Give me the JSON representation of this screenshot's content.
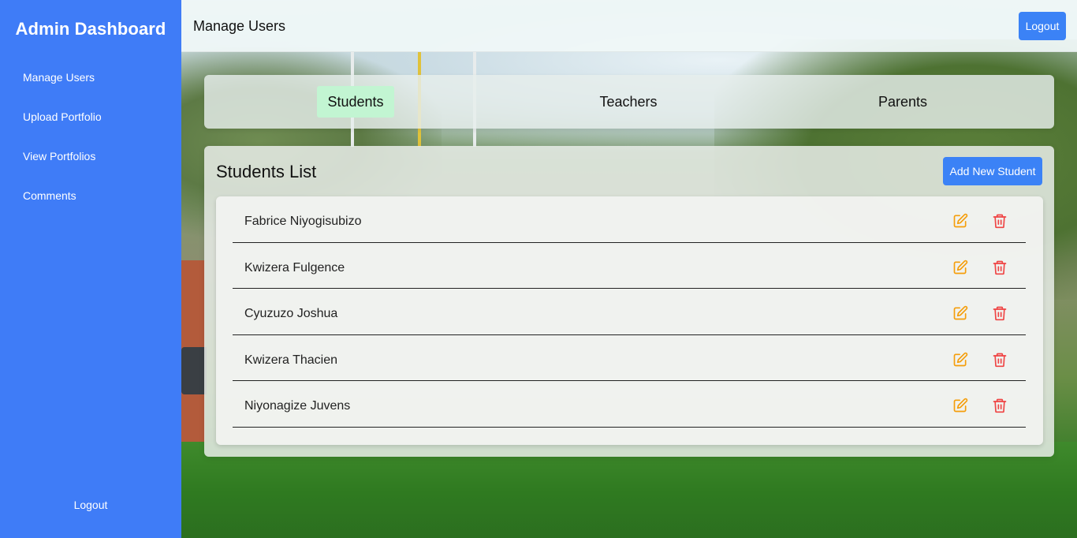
{
  "sidebar": {
    "brand": "Admin Dashboard",
    "items": [
      {
        "label": "Manage Users"
      },
      {
        "label": "Upload Portfolio"
      },
      {
        "label": "View Portfolios"
      },
      {
        "label": "Comments"
      }
    ],
    "logout_label": "Logout"
  },
  "header": {
    "title": "Manage Users",
    "logout_label": "Logout"
  },
  "tabs": [
    {
      "label": "Students",
      "active": true
    },
    {
      "label": "Teachers",
      "active": false
    },
    {
      "label": "Parents",
      "active": false
    }
  ],
  "list": {
    "title": "Students List",
    "add_label": "Add New Student",
    "students": [
      {
        "name": "Fabrice Niyogisubizo"
      },
      {
        "name": "Kwizera Fulgence"
      },
      {
        "name": "Cyuzuzo Joshua"
      },
      {
        "name": "Kwizera Thacien"
      },
      {
        "name": "Niyonagize Juvens"
      }
    ]
  },
  "colors": {
    "sidebar": "#3f7cf7",
    "primary_button": "#3b82f6",
    "active_tab": "#c2f5d2",
    "edit_icon": "#f59e0b",
    "delete_icon": "#ef4444"
  },
  "icons": {
    "edit": "edit-icon",
    "delete": "trash-icon"
  }
}
